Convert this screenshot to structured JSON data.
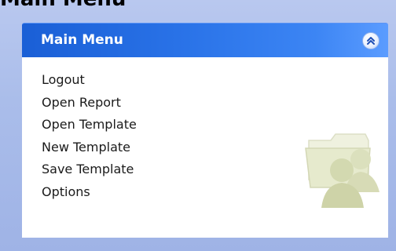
{
  "page": {
    "title": "Main Menu"
  },
  "panel": {
    "title": "Main Menu",
    "collapse_icon": "double-chevron-up-icon",
    "watermark_icon": "folder-users-icon",
    "header_color": "#2a73e8"
  },
  "menu": {
    "items": [
      {
        "label": "Logout"
      },
      {
        "label": "Open Report"
      },
      {
        "label": "Open Template"
      },
      {
        "label": "New Template"
      },
      {
        "label": "Save Template"
      },
      {
        "label": "Options"
      }
    ]
  }
}
